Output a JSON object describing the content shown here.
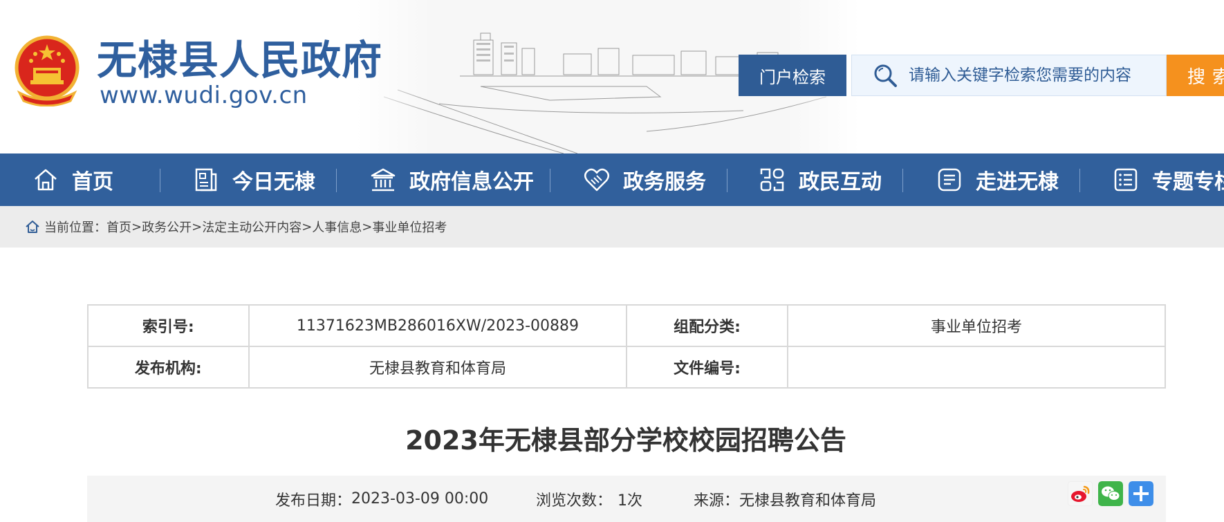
{
  "header": {
    "site_title": "无棣县人民政府",
    "site_url": "www.wudi.gov.cn",
    "portal_search_label": "门户检索",
    "search_placeholder": "请输入关键字检索您需要的内容",
    "search_button_label": "搜索"
  },
  "nav": {
    "items": [
      {
        "label": "首页",
        "icon": "home-icon"
      },
      {
        "label": "今日无棣",
        "icon": "document-icon"
      },
      {
        "label": "政府信息公开",
        "icon": "government-building-icon"
      },
      {
        "label": "政务服务",
        "icon": "handshake-heart-icon"
      },
      {
        "label": "政民互动",
        "icon": "interaction-icon"
      },
      {
        "label": "走进无棣",
        "icon": "list-card-icon"
      },
      {
        "label": "专题专栏",
        "icon": "topic-list-icon"
      }
    ]
  },
  "breadcrumb": {
    "prefix": "当前位置：",
    "items": [
      "首页",
      "政务公开",
      "法定主动公开内容",
      "人事信息",
      "事业单位招考"
    ],
    "separator": ">"
  },
  "meta": {
    "index_label": "索引号:",
    "index_value": "11371623MB286016XW/2023-00889",
    "category_label": "组配分类:",
    "category_value": "事业单位招考",
    "publisher_label": "发布机构:",
    "publisher_value": "无棣县教育和体育局",
    "doc_number_label": "文件编号:",
    "doc_number_value": ""
  },
  "article": {
    "title": "2023年无棣县部分学校校园招聘公告",
    "publish_date_label": "发布日期：",
    "publish_date": "2023-03-09 00:00",
    "views_label": "浏览次数：",
    "views": "1次",
    "source_label": "来源：",
    "source": "无棣县教育和体育局"
  },
  "share": [
    "weibo-icon",
    "wechat-icon",
    "more-share-icon"
  ],
  "colors": {
    "brand_blue": "#31609c",
    "search_orange": "#f5911e",
    "breadcrumb_bg": "#ececec"
  }
}
